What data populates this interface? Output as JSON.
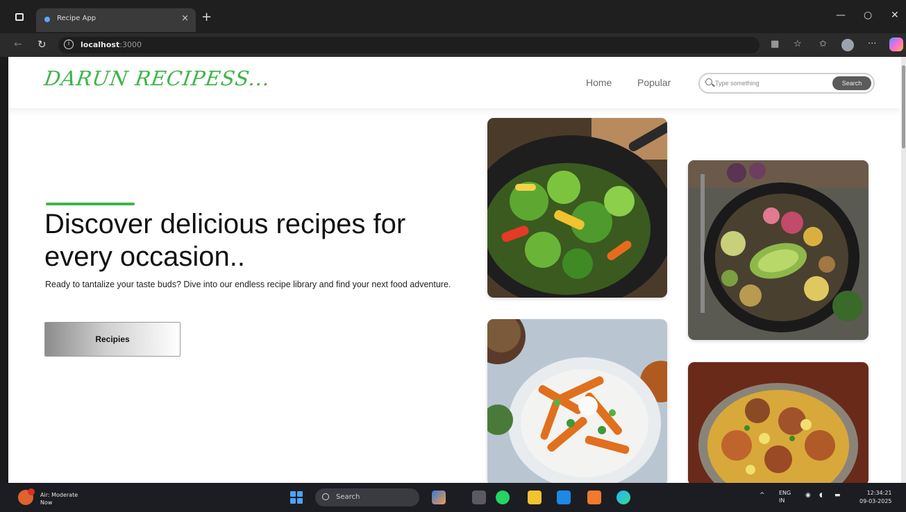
{
  "browser": {
    "tab_title": "Recipe App",
    "tab_close": "×",
    "new_tab": "+",
    "url_host": "localhost",
    "url_port": ":3000"
  },
  "site": {
    "logo": "DARUN RECIPESS...",
    "nav": {
      "home": "Home",
      "popular": "Popular"
    },
    "search": {
      "placeholder": "Type something",
      "button": "Search"
    },
    "hero": {
      "title": "Discover delicious recipes for every occasion..",
      "subtitle": "Ready to tantalize your taste buds? Dive into our endless recipe library and find your next food adventure.",
      "button": "Recipies"
    },
    "images": [
      "vegetable-stir-fry-wok",
      "avocado-buddha-bowl",
      "loaded-sweet-potato-fries",
      "chicken-rice-dish"
    ]
  },
  "taskbar": {
    "weather_title": "Air: Moderate",
    "weather_sub": "Now",
    "search_label": "Search",
    "lang": "ENG",
    "lang_sub": "IN",
    "time": "12:34:21",
    "date": "09-03-2025"
  },
  "colors": {
    "brand_green": "#3fb548",
    "search_button": "#5b5b5b"
  }
}
